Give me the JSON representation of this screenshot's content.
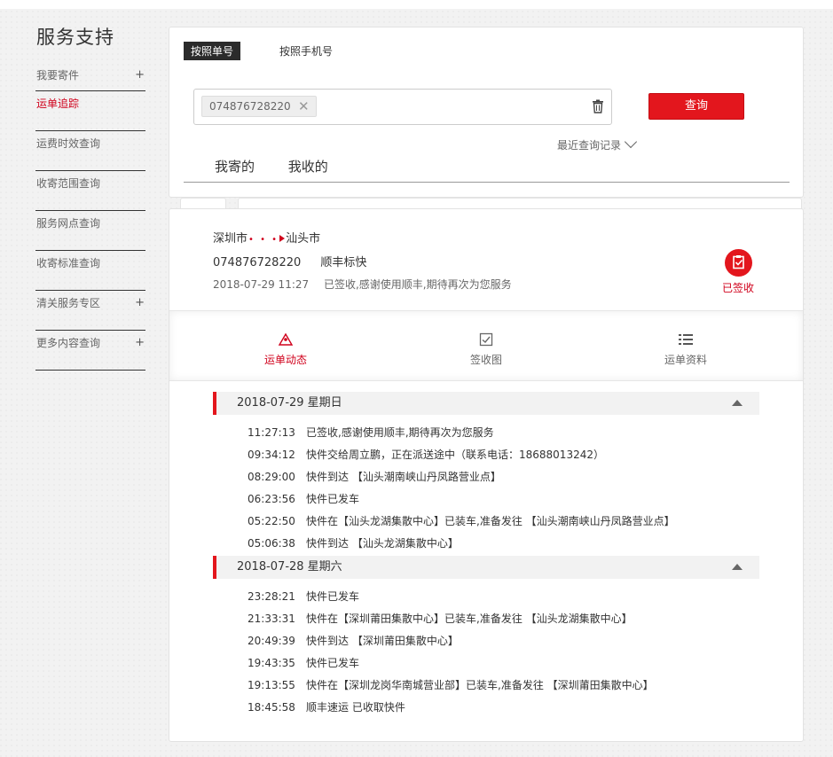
{
  "sidebar": {
    "title": "服务支持",
    "items": [
      {
        "label": "我要寄件",
        "plus": "+"
      },
      {
        "label": "运单追踪",
        "plus": ""
      },
      {
        "label": "运费时效查询",
        "plus": ""
      },
      {
        "label": "收寄范围查询",
        "plus": ""
      },
      {
        "label": "服务网点查询",
        "plus": ""
      },
      {
        "label": "收寄标准查询",
        "plus": ""
      },
      {
        "label": "清关服务专区",
        "plus": "+"
      },
      {
        "label": "更多内容查询",
        "plus": "+"
      }
    ],
    "active_color": "#d0001b"
  },
  "search": {
    "tab_by_waybill": "按照单号",
    "tab_by_phone": "按照手机号",
    "chip_value": "074876728220",
    "query_button": "查询",
    "recent_label": "最近查询记录",
    "mine_tabs": [
      "我寄的",
      "我收的"
    ]
  },
  "shipment": {
    "from_city": "深圳市",
    "to_city": "汕头市",
    "waybill_no": "074876728220",
    "service": "顺丰标快",
    "latest_time": "2018-07-29 11:27",
    "latest_msg": "已签收,感谢使用顺丰,期待再次为您服务",
    "status_label": "已签收"
  },
  "detail_tabs": [
    "运单动态",
    "签收图",
    "运单资料"
  ],
  "days": [
    {
      "date": "2018-07-29 星期日",
      "events": [
        {
          "time": "11:27:13",
          "desc": "已签收,感谢使用顺丰,期待再次为您服务"
        },
        {
          "time": "09:34:12",
          "desc": "快件交给周立鹏，正在派送途中（联系电话：18688013242）"
        },
        {
          "time": "08:29:00",
          "desc": "快件到达 【汕头潮南峡山丹凤路营业点】"
        },
        {
          "time": "06:23:56",
          "desc": "快件已发车"
        },
        {
          "time": "05:22:50",
          "desc": "快件在【汕头龙湖集散中心】已装车,准备发往 【汕头潮南峡山丹凤路营业点】"
        },
        {
          "time": "05:06:38",
          "desc": "快件到达 【汕头龙湖集散中心】"
        }
      ]
    },
    {
      "date": "2018-07-28 星期六",
      "events": [
        {
          "time": "23:28:21",
          "desc": "快件已发车"
        },
        {
          "time": "21:33:31",
          "desc": "快件在【深圳莆田集散中心】已装车,准备发往 【汕头龙湖集散中心】"
        },
        {
          "time": "20:49:39",
          "desc": "快件到达 【深圳莆田集散中心】"
        },
        {
          "time": "19:43:35",
          "desc": "快件已发车"
        },
        {
          "time": "19:13:55",
          "desc": "快件在【深圳龙岗华南城营业部】已装车,准备发往 【深圳莆田集散中心】"
        },
        {
          "time": "18:45:58",
          "desc": "顺丰速运 已收取快件"
        }
      ]
    }
  ],
  "colors": {
    "brand_red": "#e3161d",
    "dark_tab": "#2b2b2b"
  }
}
